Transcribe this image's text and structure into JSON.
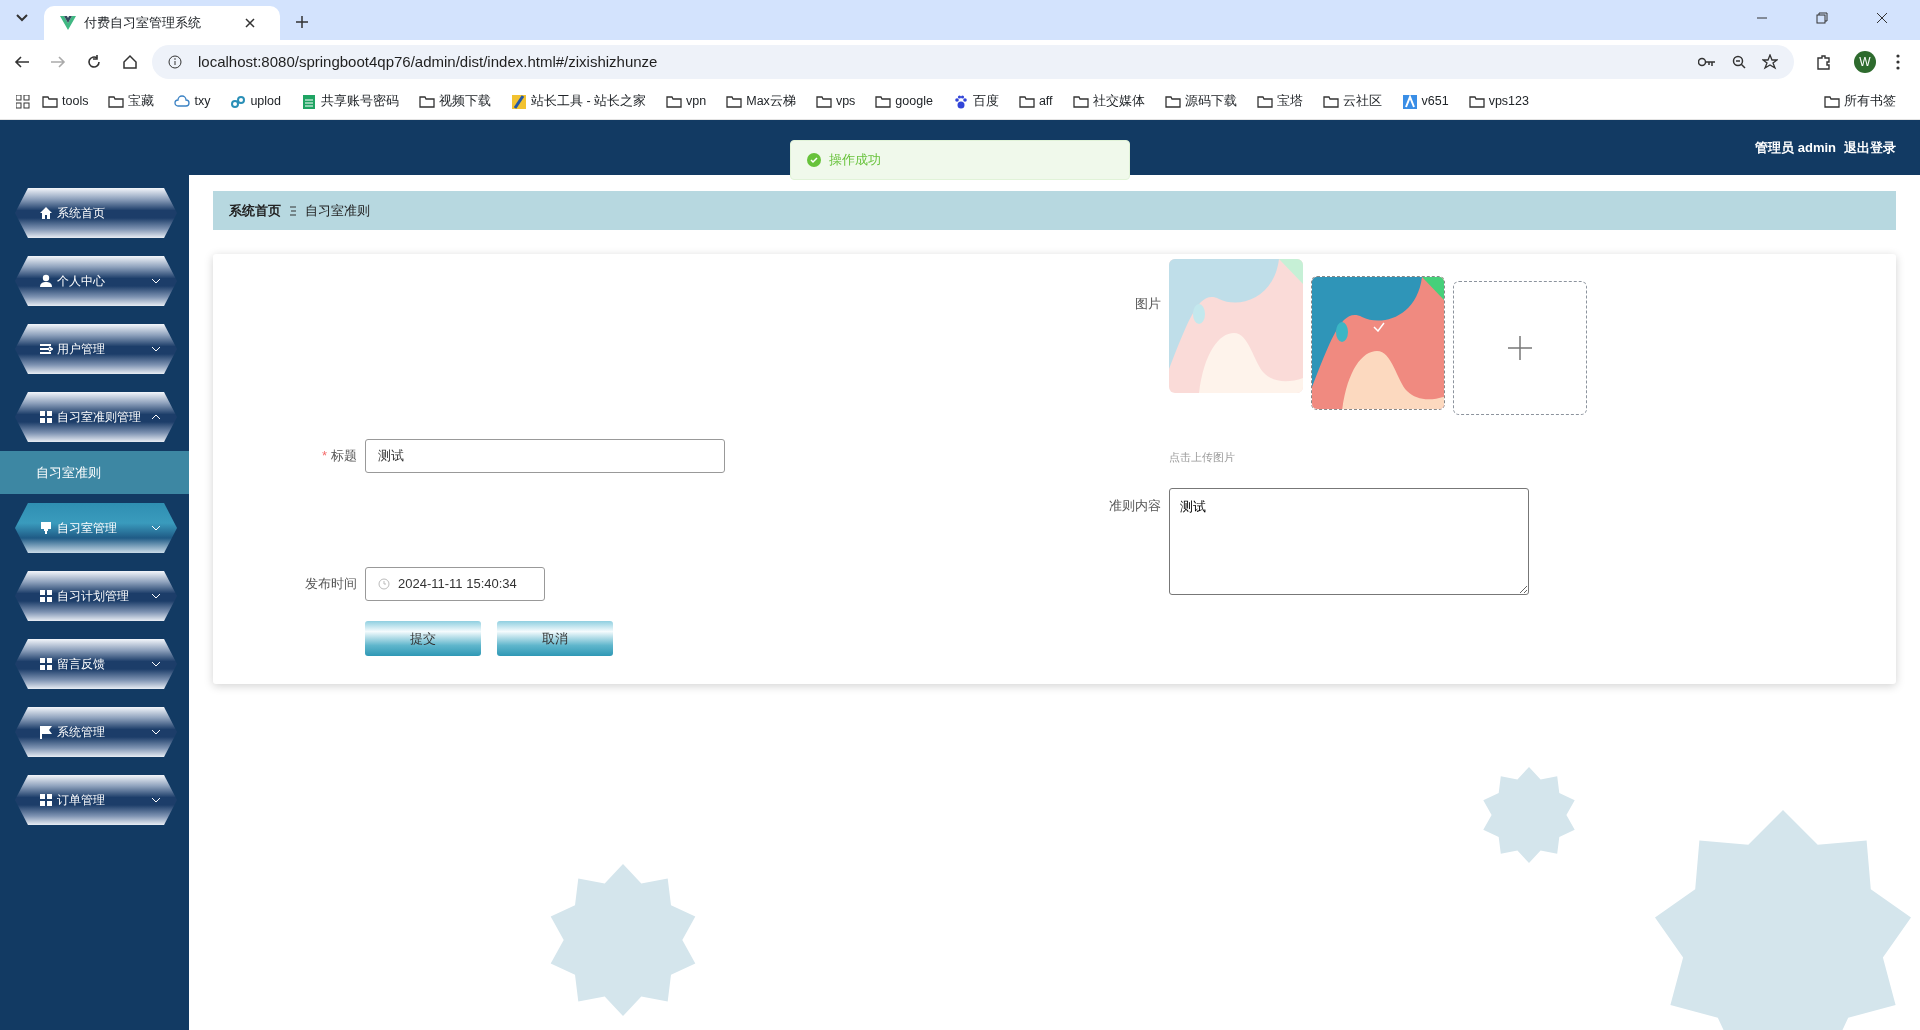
{
  "browser": {
    "tab_title": "付费自习室管理系统",
    "url": "localhost:8080/springboot4qp76/admin/dist/index.html#/zixishizhunze",
    "bookmarks": [
      {
        "label": "tools",
        "kind": "folder"
      },
      {
        "label": "宝藏",
        "kind": "folder"
      },
      {
        "label": "txy",
        "kind": "cloud"
      },
      {
        "label": "uplod",
        "kind": "link"
      },
      {
        "label": "共享账号密码",
        "kind": "sheet"
      },
      {
        "label": "视频下载",
        "kind": "folder"
      },
      {
        "label": "站长工具 - 站长之家",
        "kind": "tool"
      },
      {
        "label": "vpn",
        "kind": "folder"
      },
      {
        "label": "Max云梯",
        "kind": "folder"
      },
      {
        "label": "vps",
        "kind": "folder"
      },
      {
        "label": "google",
        "kind": "folder"
      },
      {
        "label": "百度",
        "kind": "paw"
      },
      {
        "label": "aff",
        "kind": "folder"
      },
      {
        "label": "社交媒体",
        "kind": "folder"
      },
      {
        "label": "源码下载",
        "kind": "folder"
      },
      {
        "label": "宝塔",
        "kind": "folder"
      },
      {
        "label": "云社区",
        "kind": "folder"
      },
      {
        "label": "v651",
        "kind": "app"
      },
      {
        "label": "vps123",
        "kind": "folder"
      }
    ],
    "all_bookmarks": "所有书签",
    "profile_initial": "W"
  },
  "header": {
    "user": "管理员 admin",
    "logout": "退出登录"
  },
  "toast": {
    "message": "操作成功"
  },
  "sidebar": {
    "items": [
      {
        "label": "系统首页",
        "kind": "home",
        "highlighted": false
      },
      {
        "label": "个人中心",
        "kind": "user",
        "expanded": false,
        "highlighted": false
      },
      {
        "label": "用户管理",
        "kind": "list",
        "expanded": false,
        "highlighted": false
      },
      {
        "label": "自习室准则管理",
        "kind": "grid",
        "expanded": true,
        "highlighted": false,
        "children": [
          {
            "label": "自习室准则",
            "selected": true
          }
        ]
      },
      {
        "label": "自习室管理",
        "kind": "pin",
        "expanded": false,
        "highlighted": true
      },
      {
        "label": "自习计划管理",
        "kind": "grid",
        "expanded": false,
        "highlighted": false
      },
      {
        "label": "留言反馈",
        "kind": "grid",
        "expanded": false,
        "highlighted": false
      },
      {
        "label": "系统管理",
        "kind": "flag",
        "expanded": false,
        "highlighted": false
      },
      {
        "label": "订单管理",
        "kind": "grid",
        "expanded": false,
        "highlighted": false
      }
    ]
  },
  "breadcrumb": [
    "系统首页",
    "自习室准则"
  ],
  "form": {
    "title_label": "标题",
    "required_mark": "*",
    "title_value": "测试",
    "date_label": "发布时间",
    "date_value": "2024-11-11 15:40:34",
    "submit": "提交",
    "cancel": "取消",
    "image_label": "图片",
    "images": [
      {
        "kind": "picture",
        "faded": true
      },
      {
        "kind": "picture",
        "faded": false
      }
    ],
    "upload_hint": "点击上传图片",
    "content_label": "准则内容",
    "content_value": "测试"
  }
}
